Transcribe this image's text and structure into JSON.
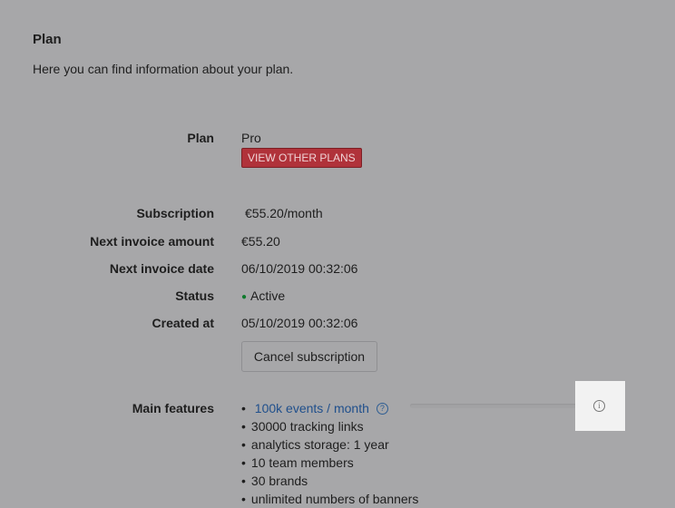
{
  "section": {
    "title": "Plan",
    "description": "Here you can find information about your plan."
  },
  "plan": {
    "label": "Plan",
    "value": "Pro",
    "view_plans_button": "VIEW OTHER PLANS"
  },
  "details": {
    "subscription_label": "Subscription",
    "subscription_value": "€55.20/month",
    "next_invoice_amount_label": "Next invoice amount",
    "next_invoice_amount_value": "€55.20",
    "next_invoice_date_label": "Next invoice date",
    "next_invoice_date_value": "06/10/2019 00:32:06",
    "status_label": "Status",
    "status_value": "Active",
    "status_color": "#0f7a2c",
    "created_at_label": "Created at",
    "created_at_value": "05/10/2019 00:32:06",
    "cancel_button": "Cancel subscription"
  },
  "features": {
    "label": "Main features",
    "items": [
      "100k events / month",
      "30000 tracking links",
      "analytics storage: 1 year",
      "10 team members",
      "30 brands",
      "unlimited numbers of banners"
    ]
  },
  "icons": {
    "help": "question-circle-icon",
    "info": "info-icon",
    "help_glyph": "?",
    "info_glyph": "i"
  },
  "colors": {
    "background": "#a7a7a9",
    "plan_button": "#b0323a",
    "link": "#1f4f8c"
  }
}
